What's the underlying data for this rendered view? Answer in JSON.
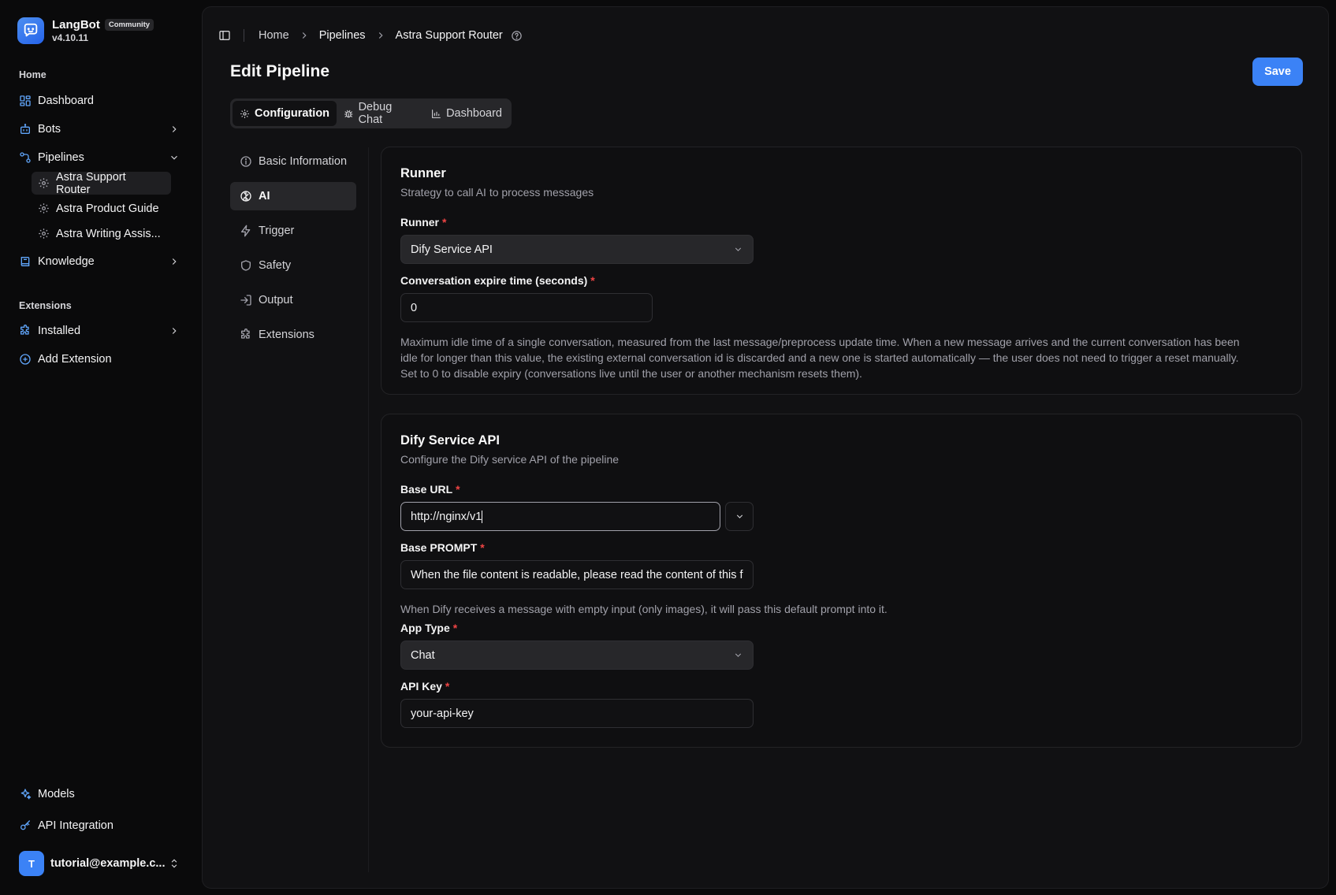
{
  "app": {
    "name": "LangBot",
    "badge": "Community",
    "version": "v4.10.11"
  },
  "sidebar": {
    "home_section": "Home",
    "items": {
      "dashboard": "Dashboard",
      "bots": "Bots",
      "pipelines": "Pipelines",
      "knowledge": "Knowledge"
    },
    "pipelines_children": [
      "Astra Support Router",
      "Astra Product Guide",
      "Astra Writing Assis..."
    ],
    "extensions_section": "Extensions",
    "extension_items": {
      "installed": "Installed",
      "add_extension": "Add Extension"
    },
    "bottom_items": {
      "models": "Models",
      "api_integration": "API Integration"
    },
    "user": {
      "initial": "T",
      "email": "tutorial@example.c..."
    }
  },
  "breadcrumb": [
    "Home",
    "Pipelines",
    "Astra Support Router"
  ],
  "page": {
    "title": "Edit Pipeline",
    "save_label": "Save"
  },
  "tabs": [
    "Configuration",
    "Debug Chat",
    "Dashboard"
  ],
  "active_tab": "Configuration",
  "subnav": [
    "Basic Information",
    "AI",
    "Trigger",
    "Safety",
    "Output",
    "Extensions"
  ],
  "active_subnav": "AI",
  "runner_card": {
    "title": "Runner",
    "description": "Strategy to call AI to process messages",
    "runner_label": "Runner",
    "runner_value": "Dify Service API",
    "expire_label": "Conversation expire time (seconds)",
    "expire_value": "0",
    "expire_help_1": "Maximum idle time of a single conversation, measured from the last message/preprocess update time. When a new message arrives and the current conversation has been",
    "expire_help_2": "idle for longer than this value, the existing external conversation id is discarded and a new one is started automatically — the user does not need to trigger a reset manually.",
    "expire_help_3": "Set to 0 to disable expiry (conversations live until the user or another mechanism resets them)."
  },
  "dify_card": {
    "title": "Dify Service API",
    "description": "Configure the Dify service API of the pipeline",
    "base_url_label": "Base URL",
    "base_url_value": "http://nginx/v1",
    "base_prompt_label": "Base PROMPT",
    "base_prompt_value": "When the file content is readable, please read the content of this f",
    "base_prompt_help": "When Dify receives a message with empty input (only images), it will pass this default prompt into it.",
    "app_type_label": "App Type",
    "app_type_value": "Chat",
    "api_key_label": "API Key",
    "api_key_value": "your-api-key"
  },
  "required_mark": "*",
  "colors": {
    "accent": "#3b82f6",
    "required": "#ef4444",
    "background": "#0a0a0b",
    "panel": "#111113"
  }
}
